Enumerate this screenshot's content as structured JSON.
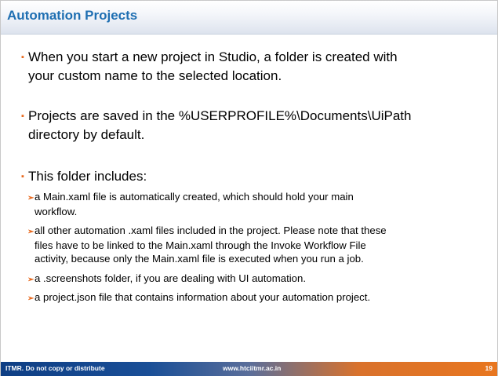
{
  "slide": {
    "title": "Automation Projects",
    "bullets": [
      {
        "mark": "▪",
        "line1": "When you start a new project in Studio, a folder is created with",
        "line2": "your custom name to the selected location."
      },
      {
        "mark": "▪",
        "line1": "Projects are saved in the %USERPROFILE%\\Documents\\UiPath",
        "line2": "directory by default."
      },
      {
        "mark": "▪",
        "line1": "This folder includes:"
      }
    ],
    "subitems": [
      {
        "arrow": "➢",
        "lines": [
          "a Main.xaml file is automatically created, which should hold your main",
          "workflow."
        ]
      },
      {
        "arrow": "➢",
        "lines": [
          "all other automation .xaml files included in the project. Please note that these",
          "files have to be linked to the Main.xaml through the Invoke Workflow File",
          "activity, because only the Main.xaml file is executed when you run a job."
        ]
      },
      {
        "arrow": "➢",
        "lines": [
          "a .screenshots folder, if you are dealing with UI automation."
        ]
      },
      {
        "arrow": "➢",
        "lines": [
          "a project.json file that contains information about your automation project."
        ]
      }
    ]
  },
  "footer": {
    "left_text": "ITMR. Do not copy or distribute",
    "center_text": "www.htciitmr.ac.in",
    "page_number": "19"
  },
  "colors": {
    "title": "#1f6fb2",
    "bullet_mark": "#e8681c",
    "footer_start": "#0e3e84",
    "footer_end": "#e8761f"
  }
}
